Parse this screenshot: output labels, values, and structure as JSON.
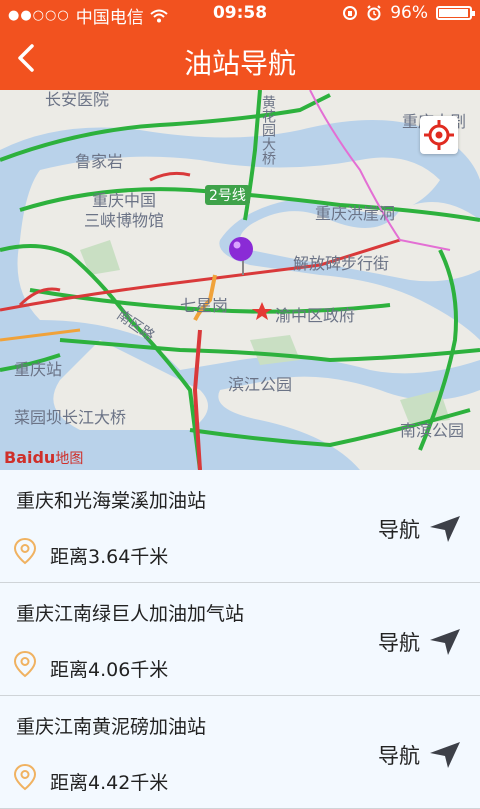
{
  "status": {
    "carrier": "中国电信",
    "time": "09:58",
    "battery": "96%"
  },
  "header": {
    "title": "油站导航"
  },
  "map": {
    "labels": [
      "长安医院",
      "鲁家岩",
      "重庆中国",
      "三峡博物馆",
      "2号线",
      "重庆洪崖洞",
      "解放碑步行街",
      "七星岗",
      "渝中区政府",
      "重庆站",
      "滨江公园",
      "菜园坝长江大桥",
      "南滨公园",
      "南区路",
      "重庆大剧",
      "黄花园大桥"
    ],
    "logo": "Baidu",
    "logo_suffix": "地图"
  },
  "stations": [
    {
      "name": "重庆和光海棠溪加油站",
      "distance": "距离3.64千米",
      "nav_label": "导航"
    },
    {
      "name": "重庆江南绿巨人加油加气站",
      "distance": "距离4.06千米",
      "nav_label": "导航"
    },
    {
      "name": "重庆江南黄泥磅加油站",
      "distance": "距离4.42千米",
      "nav_label": "导航"
    }
  ],
  "colors": {
    "accent": "#f2521f",
    "river": "#b9d2ea",
    "road_green": "#2db13d",
    "road_red": "#d9393a",
    "pin": "#8a2bd6"
  }
}
